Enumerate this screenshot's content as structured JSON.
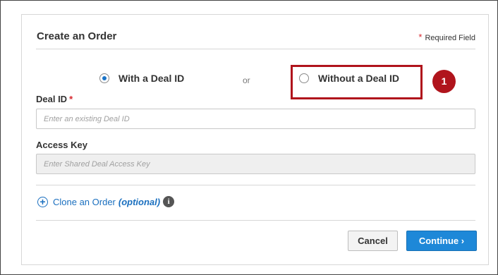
{
  "form": {
    "title": "Create an Order",
    "required_star": "*",
    "required_text": "Required Field",
    "radio_with_label": "With a Deal ID",
    "radio_with_checked": true,
    "or_text": "or",
    "radio_without_label": "Without a Deal ID",
    "callout_number": "1",
    "deal_id_label": "Deal ID",
    "deal_id_star": "*",
    "deal_id_placeholder": "Enter an existing Deal ID",
    "access_key_label": "Access Key",
    "access_key_placeholder": "Enter Shared Deal Access Key",
    "clone_plus": "+",
    "clone_label": "Clone an Order",
    "clone_optional": "(optional)",
    "info_glyph": "i",
    "cancel_label": "Cancel",
    "continue_label": "Continue",
    "continue_chevron": "›"
  },
  "colors": {
    "accent_blue": "#1e88d8",
    "highlight_red": "#b0141c",
    "required_red": "#d7282f"
  }
}
